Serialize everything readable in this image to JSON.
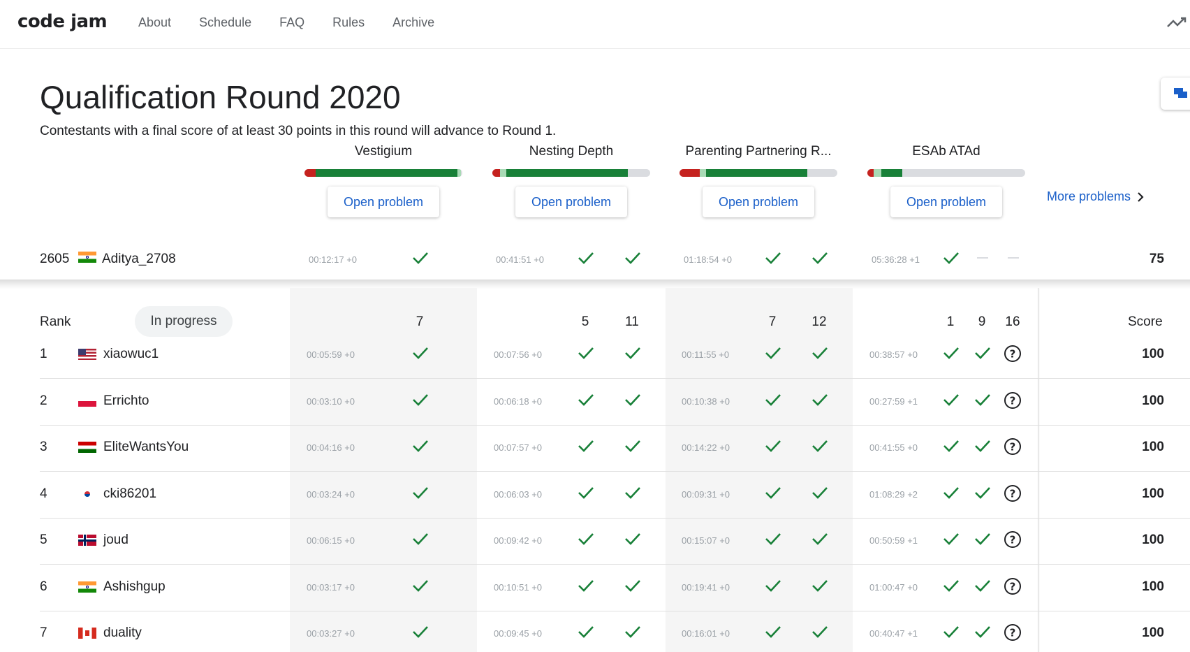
{
  "header": {
    "logo": "code jam",
    "nav": [
      "About",
      "Schedule",
      "FAQ",
      "Rules",
      "Archive"
    ]
  },
  "page": {
    "title": "Qualification Round 2020",
    "subtitle": "Contestants with a final score of at least 30 points in this round will advance to Round 1.",
    "more_problems": "More problems"
  },
  "problems": [
    {
      "name": "Vestigium",
      "button": "Open problem",
      "progress": [
        [
          "#c5221f",
          0.07
        ],
        [
          "#a8dab5",
          0.0
        ],
        [
          "#188038",
          0.9
        ],
        [
          "#a8dab5",
          0.02
        ]
      ]
    },
    {
      "name": "Nesting Depth",
      "button": "Open problem",
      "progress": [
        [
          "#c5221f",
          0.05
        ],
        [
          "#a8dab5",
          0.04
        ],
        [
          "#188038",
          0.77
        ]
      ]
    },
    {
      "name": "Parenting Partnering R...",
      "button": "Open problem",
      "progress": [
        [
          "#c5221f",
          0.13
        ],
        [
          "#a8dab5",
          0.04
        ],
        [
          "#188038",
          0.64
        ]
      ]
    },
    {
      "name": "ESAb ATAd",
      "button": "Open problem",
      "progress": [
        [
          "#c5221f",
          0.04
        ],
        [
          "#a8dab5",
          0.05
        ],
        [
          "#188038",
          0.13
        ]
      ]
    }
  ],
  "my_row": {
    "rank": "2605",
    "name": "Aditya_2708",
    "flag": "in",
    "times": [
      "00:12:17 +0",
      "00:41:51 +0",
      "01:18:54 +0",
      "05:36:28 +1"
    ],
    "results": [
      [
        "check"
      ],
      [
        "check",
        "check"
      ],
      [
        "check",
        "check"
      ],
      [
        "check",
        "dash",
        "dash"
      ]
    ],
    "score": "75"
  },
  "table": {
    "rank_header": "Rank",
    "filter_chip": "In progress",
    "score_header": "Score",
    "points": [
      [
        "7"
      ],
      [
        "5",
        "11"
      ],
      [
        "7",
        "12"
      ],
      [
        "1",
        "9",
        "16"
      ]
    ],
    "rows": [
      {
        "rank": "1",
        "name": "xiaowuc1",
        "flag": "us",
        "times": [
          "00:05:59 +0",
          "00:07:56 +0",
          "00:11:55 +0",
          "00:38:57 +0"
        ],
        "score": "100"
      },
      {
        "rank": "2",
        "name": "Errichto",
        "flag": "pl",
        "times": [
          "00:03:10 +0",
          "00:06:18 +0",
          "00:10:38 +0",
          "00:27:59 +1"
        ],
        "score": "100"
      },
      {
        "rank": "3",
        "name": "EliteWantsYou",
        "flag": "tj",
        "times": [
          "00:04:16 +0",
          "00:07:57 +0",
          "00:14:22 +0",
          "00:41:55 +0"
        ],
        "score": "100"
      },
      {
        "rank": "4",
        "name": "cki86201",
        "flag": "kr",
        "times": [
          "00:03:24 +0",
          "00:06:03 +0",
          "00:09:31 +0",
          "01:08:29 +2"
        ],
        "score": "100"
      },
      {
        "rank": "5",
        "name": "joud",
        "flag": "no",
        "times": [
          "00:06:15 +0",
          "00:09:42 +0",
          "00:15:07 +0",
          "00:50:59 +1"
        ],
        "score": "100"
      },
      {
        "rank": "6",
        "name": "Ashishgup",
        "flag": "in",
        "times": [
          "00:03:17 +0",
          "00:10:51 +0",
          "00:19:41 +0",
          "01:00:47 +0"
        ],
        "score": "100"
      },
      {
        "rank": "7",
        "name": "duality",
        "flag": "ca",
        "times": [
          "00:03:27 +0",
          "00:09:45 +0",
          "00:16:01 +0",
          "00:40:47 +1"
        ],
        "score": "100"
      }
    ]
  },
  "colors": {
    "accent": "#1a5fc9",
    "check": "#188038",
    "wrong": "#c5221f"
  }
}
